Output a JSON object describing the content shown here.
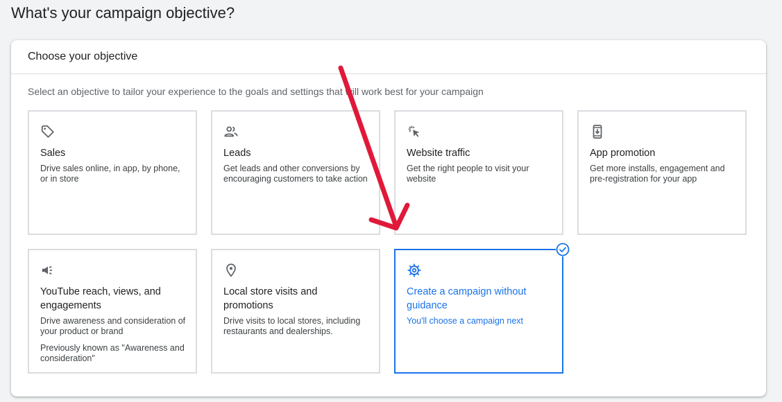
{
  "page": {
    "title": "What's your campaign objective?"
  },
  "panel": {
    "title": "Choose your objective",
    "subtitle": "Select an objective to tailor your experience to the goals and settings that will work best for your campaign"
  },
  "objectives": [
    {
      "title": "Sales",
      "desc": "Drive sales online, in app, by phone, or in store",
      "icon": "tag-icon"
    },
    {
      "title": "Leads",
      "desc": "Get leads and other conversions by encouraging customers to take action",
      "icon": "people-icon"
    },
    {
      "title": "Website traffic",
      "desc": "Get the right people to visit your website",
      "icon": "cursor-click-icon"
    },
    {
      "title": "App promotion",
      "desc": "Get more installs, engagement and pre-registration for your app",
      "icon": "phone-download-icon"
    },
    {
      "title": "YouTube reach, views, and engagements",
      "desc": "Drive awareness and consideration of your product or brand",
      "desc2": "Previously known as \"Awareness and consideration\"",
      "icon": "megaphone-icon"
    },
    {
      "title": "Local store visits and promotions",
      "desc": "Drive visits to local stores, including restaurants and dealerships.",
      "icon": "location-pin-icon"
    },
    {
      "title": "Create a campaign without guidance",
      "desc": "You'll choose a campaign next",
      "icon": "gear-icon",
      "selected": true
    }
  ],
  "colors": {
    "accent": "#1a73e8",
    "annotation_arrow": "#e0193a",
    "border": "#dadce0"
  }
}
